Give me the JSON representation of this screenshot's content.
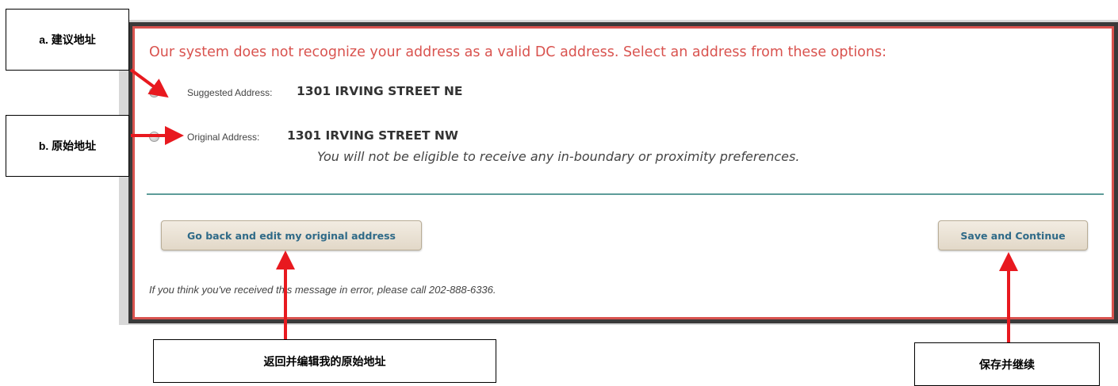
{
  "dialog": {
    "heading": "Our system does not recognize your address as a valid DC address. Select an address from these options:",
    "options": [
      {
        "label": "Suggested Address:",
        "value": "1301 IRVING STREET NE",
        "selected": false
      },
      {
        "label": "Original Address:",
        "value": "1301 IRVING STREET NW",
        "selected": false
      }
    ],
    "original_note": "You will not be eligible to receive any in-boundary or proximity preferences.",
    "back_button": "Go back and edit my original address",
    "save_button": "Save and Continue",
    "footer": "If you think you've received this message in error, please call 202-888-6336."
  },
  "annotations": {
    "a": "a. 建议地址",
    "b": "b. 原始地址",
    "back": "返回并编辑我的原始地址",
    "save": "保存并继续"
  },
  "colors": {
    "heading": "#d9534f",
    "border": "#d9534f",
    "divider": "#5d9c99",
    "button_text": "#2f6a88",
    "arrow": "#e8191f"
  }
}
